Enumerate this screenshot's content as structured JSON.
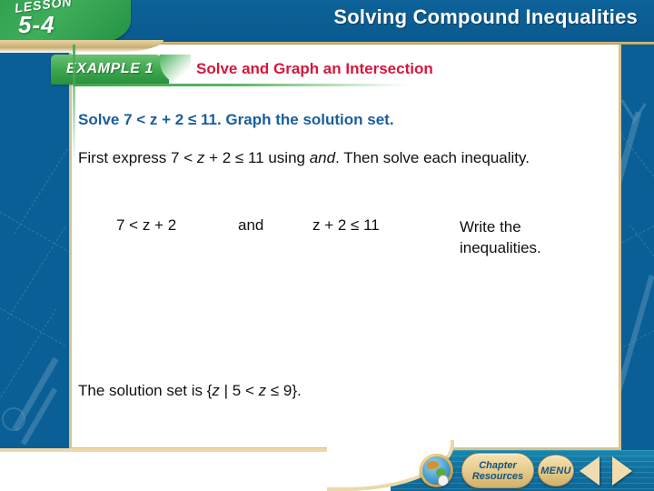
{
  "banner": {
    "title": "Solving Compound Inequalities"
  },
  "lesson_tab": {
    "word": "LESSON",
    "number": "5-4"
  },
  "example": {
    "tab_label": "EXAMPLE 1",
    "title": "Solve and Graph an Intersection"
  },
  "content": {
    "prompt": "Solve 7 < z + 2 ≤ 11. Graph the solution set.",
    "instruction_part1": "First express 7 < ",
    "instruction_var": "z",
    "instruction_part2": " + 2 ≤ 11 using ",
    "instruction_and": "and",
    "instruction_part3": ". Then solve each inequality.",
    "inequality_left": "7 < z + 2",
    "conjunction": "and",
    "inequality_right": "z + 2 ≤ 11",
    "step_note": "Write the inequalities.",
    "solution_prefix": "The solution set is {",
    "solution_var": "z",
    "solution_middle": " | 5 < ",
    "solution_var2": "z",
    "solution_suffix": " ≤ 9}."
  },
  "toolbar": {
    "globe_label": "globe-icon",
    "chapter_line1": "Chapter",
    "chapter_line2": "Resources",
    "menu_label": "MENU",
    "prev_label": "◀",
    "next_label": "▶"
  },
  "colors": {
    "banner_blue": "#0a5a8e",
    "lesson_green": "#3fae5a",
    "example_red": "#d6173b",
    "prompt_blue": "#1a5e9e",
    "gold_border": "#d8c28c",
    "toolbar_teal": "#1278a8"
  }
}
